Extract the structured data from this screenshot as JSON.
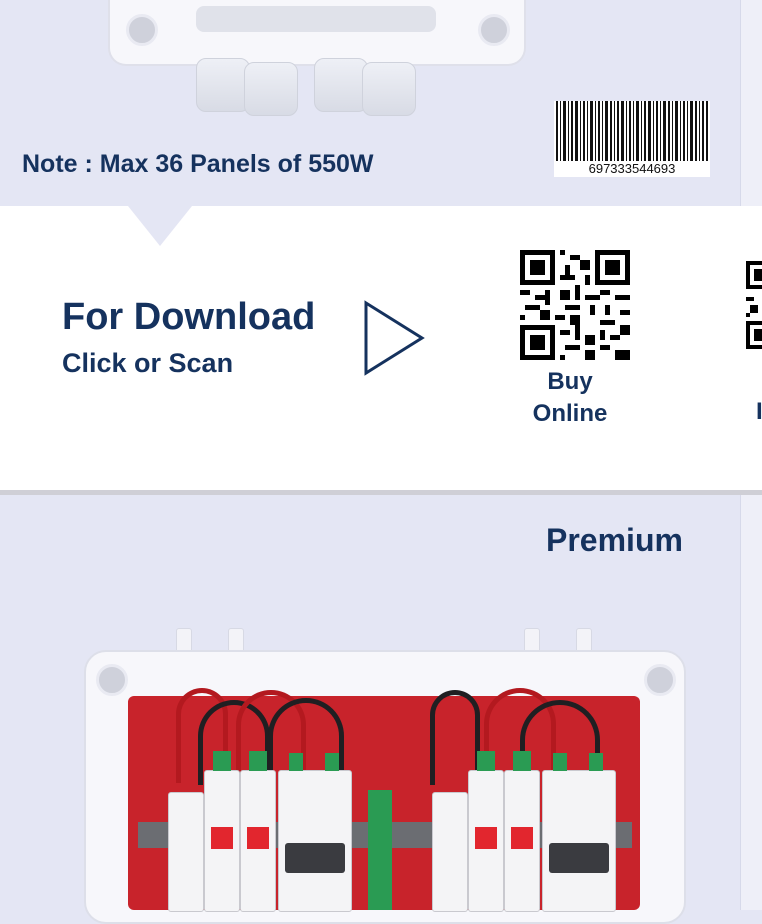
{
  "top_section": {
    "note": "Note : Max 36 Panels of 550W",
    "barcode_number": "697333544693"
  },
  "download_section": {
    "title": "For Download",
    "subtitle": "Click or Scan",
    "qr_label_line1": "Buy",
    "qr_label_line2": "Online",
    "cut_label": "I"
  },
  "product_section": {
    "title": "Premium"
  },
  "colors": {
    "background": "#e4e6f4",
    "navy_text": "#15325e",
    "enclosure_red": "#c8232b",
    "breaker_green": "#2a9b53"
  }
}
